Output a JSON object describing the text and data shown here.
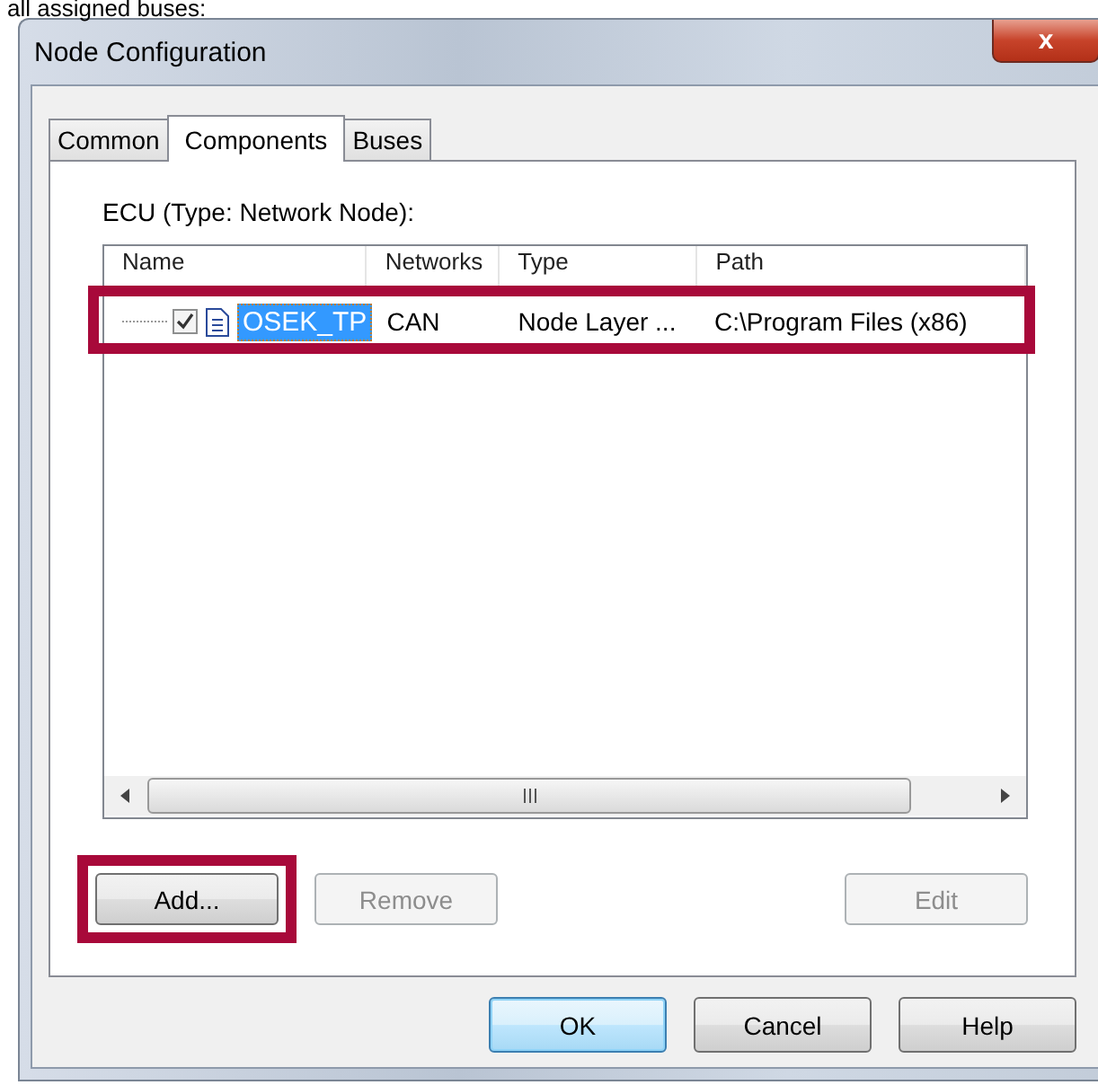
{
  "caption": "all assigned buses:",
  "window": {
    "title": "Node Configuration",
    "close": "x"
  },
  "tabs": [
    {
      "label": "Common",
      "selected": false
    },
    {
      "label": "Components",
      "selected": true
    },
    {
      "label": "Buses",
      "selected": false
    }
  ],
  "section_label": "ECU (Type: Network Node):",
  "table": {
    "columns": [
      "Name",
      "Networks",
      "Type",
      "Path"
    ],
    "rows": [
      {
        "checked": true,
        "selected": true,
        "cells": [
          "OSEK_TP",
          "CAN",
          "Node Layer ...",
          "C:\\Program Files (x86)"
        ]
      }
    ]
  },
  "list_buttons": [
    {
      "label": "Add...",
      "disabled": false,
      "highlighted": true
    },
    {
      "label": "Remove",
      "disabled": true,
      "highlighted": false
    },
    {
      "label": "Edit",
      "disabled": true,
      "highlighted": false
    }
  ],
  "dialog_buttons": [
    {
      "label": "OK",
      "default": true
    },
    {
      "label": "Cancel",
      "default": false
    },
    {
      "label": "Help",
      "default": false
    }
  ]
}
